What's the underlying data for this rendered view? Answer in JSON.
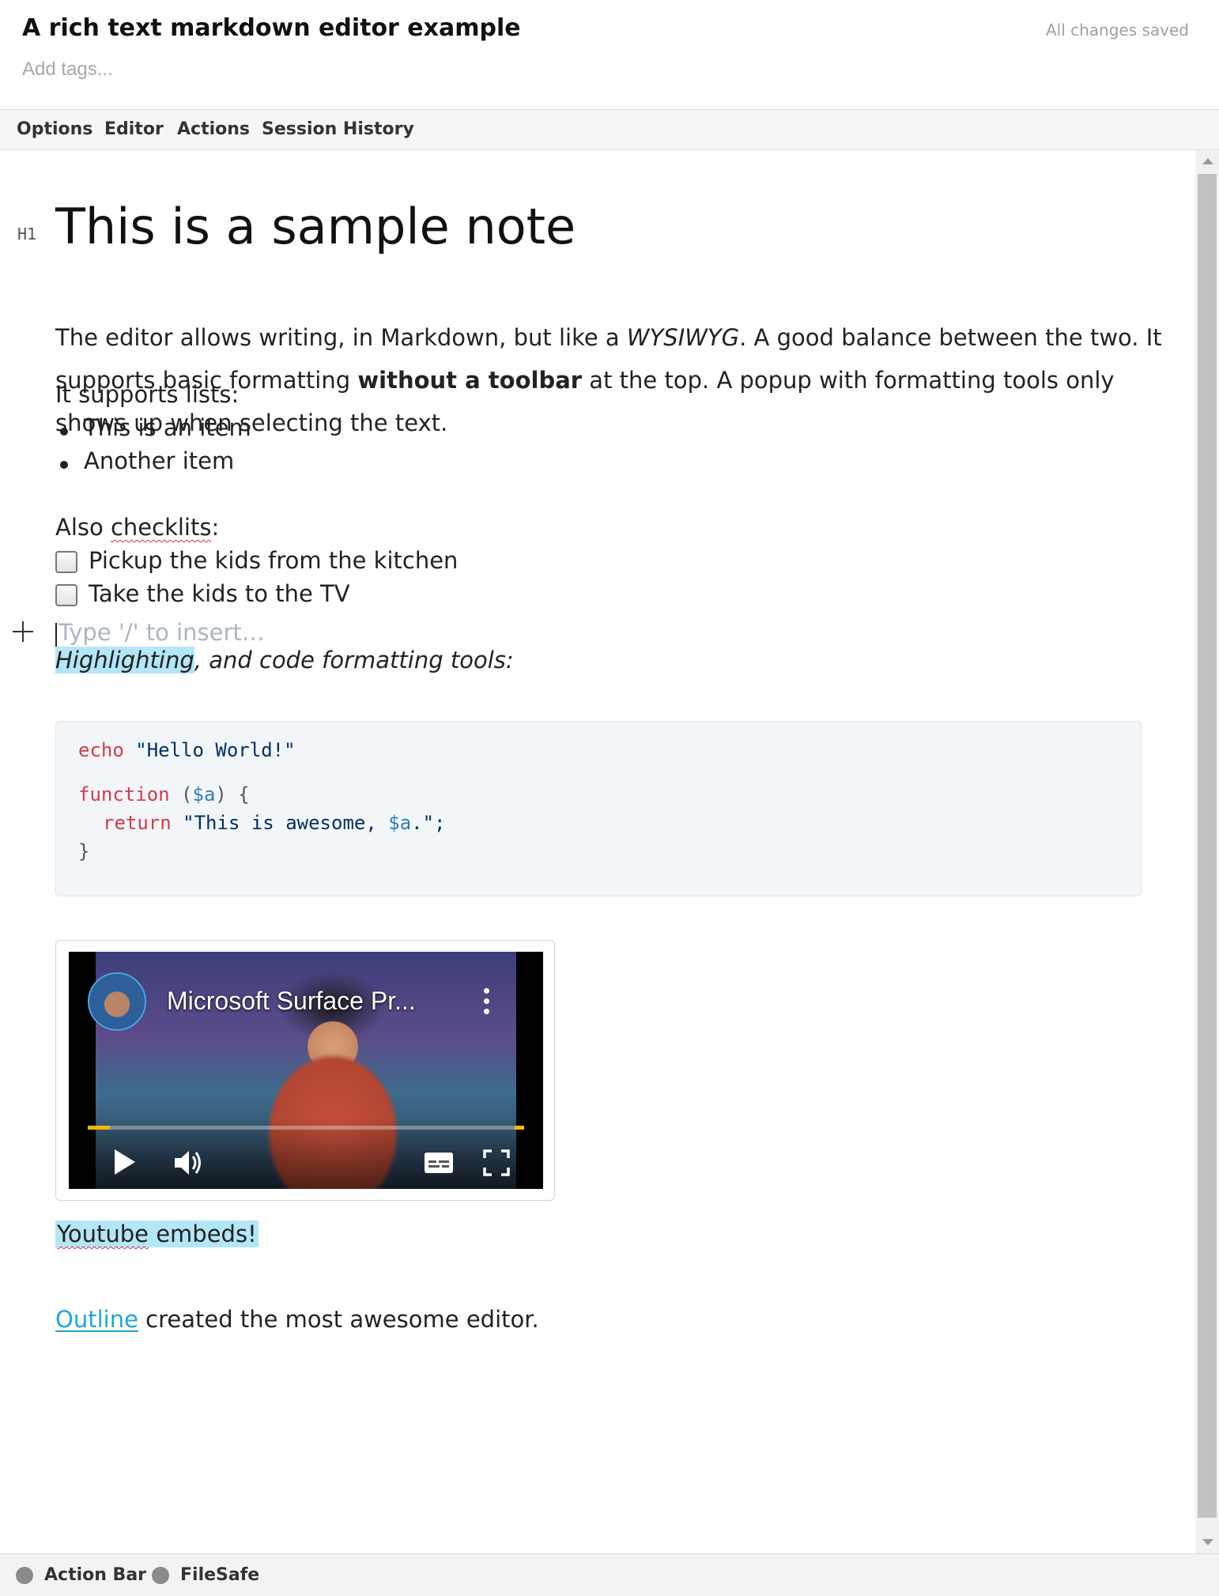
{
  "header": {
    "title": "A rich text markdown editor example",
    "tags_placeholder": "Add tags...",
    "save_status": "All changes saved"
  },
  "menu": [
    "Options",
    "Editor",
    "Actions",
    "Session History"
  ],
  "note": {
    "heading_marker": "H1",
    "heading": "This is a sample note",
    "intro": {
      "p1": "The editor allows writing, in Markdown, but like a ",
      "em": "WYSIWYG",
      "p2": ". A good balance between the two. It supports basic formatting ",
      "bold": "without a toolbar",
      "p3": " at the top. A popup with formatting tools only shows up when selecting the text."
    },
    "lists_label": "It supports lists:",
    "list_items": [
      "This is an item",
      "Another item"
    ],
    "insert_placeholder": "Type '/' to insert…",
    "checklist_prefix": "Also ",
    "checklist_word": "checklits",
    "checklist_suffix": ":",
    "checklist": [
      "Pickup the kids from the kitchen",
      "Take the kids to the TV"
    ],
    "highlight_word": "Highlighting",
    "highlight_rest": ", and code formatting tools:",
    "code": {
      "l1_kw": "echo",
      "l1_str": " \"Hello World!\"",
      "l2_kw": "function",
      "l2_open": " (",
      "l2_var": "$a",
      "l2_close": ") {",
      "l3_kw": "return",
      "l3_str": " \"This is awesome, ",
      "l3_var": "$a",
      "l3_end": ".\";",
      "l4": "}"
    },
    "video_title": "Microsoft Surface Pr...",
    "youtube_word": "Youtube",
    "youtube_rest": " embeds!",
    "outline_link": "Outline",
    "outline_rest": " created the most awesome editor."
  },
  "video_progress_fraction": 0.05,
  "footer": [
    "Action Bar",
    "FileSafe"
  ],
  "colors": {
    "highlight": "#b3e6f7",
    "link": "#1ba9d6",
    "code_keyword": "#d73a49",
    "code_string": "#032f62",
    "code_variable": "#2e7fb8"
  }
}
